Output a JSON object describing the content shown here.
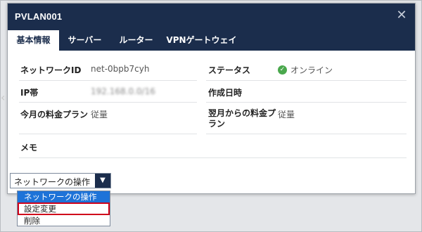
{
  "dialog": {
    "title": "PVLAN001",
    "close_glyph": "✕"
  },
  "tabs": [
    {
      "label": "基本情報",
      "active": true
    },
    {
      "label": "サーバー",
      "active": false
    },
    {
      "label": "ルーター",
      "active": false
    },
    {
      "label": "VPNゲートウェイ",
      "active": false
    }
  ],
  "info": {
    "network_id_label": "ネットワークID",
    "network_id_value": "net-0bpb7cyh",
    "status_label": "ステータス",
    "status_value": "オンライン",
    "ip_label": "IP帯",
    "ip_value": "192.168.0.0/16",
    "created_label": "作成日時",
    "created_value": "",
    "plan_this_month_label": "今月の料金プラン",
    "plan_this_month_value": "従量",
    "plan_next_month_label": "翌月からの料金プ\nラン",
    "plan_next_month_value": "従量",
    "memo_label": "メモ",
    "memo_value": ""
  },
  "operation": {
    "selected": "ネットワークの操作",
    "options": [
      "ネットワークの操作",
      "設定変更",
      "削除"
    ],
    "highlighted_index": 0,
    "annotated_index": 1
  },
  "colors": {
    "header_bg": "#1b2d4c",
    "highlight": "#1e73d8",
    "status_ok": "#4aa84d",
    "annotation_red": "#d0021b"
  },
  "icons": {
    "close": "close-icon",
    "status": "check-circle-icon",
    "dropdown": "chevron-down-icon",
    "bg_arrow": "chevron-left-icon"
  }
}
